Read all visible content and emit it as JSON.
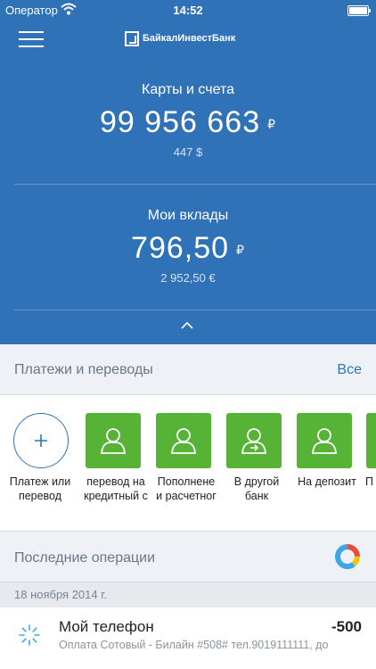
{
  "status": {
    "carrier": "Оператор",
    "time": "14:52"
  },
  "header": {
    "logo_text": "БайкалИнвестБанк"
  },
  "cards": {
    "title": "Карты и счета",
    "amount": "99 956 663",
    "currency": "₽",
    "sub": "447 $"
  },
  "deposits": {
    "title": "Мои вклады",
    "amount": "796,50",
    "currency": "₽",
    "sub": "2 952,50 €"
  },
  "payments": {
    "title": "Платежи и переводы",
    "all_label": "Все",
    "items": [
      {
        "label1": "Платеж или",
        "label2": "перевод",
        "icon": "plus-icon"
      },
      {
        "label1": "перевод на",
        "label2": "кредитный с",
        "icon": "person-icon"
      },
      {
        "label1": "Пополнене",
        "label2": "и расчетног",
        "icon": "person-icon"
      },
      {
        "label1": "В другой",
        "label2": "банк",
        "icon": "person-transfer-icon"
      },
      {
        "label1": "На депозит",
        "label2": "",
        "icon": "person-icon"
      },
      {
        "label1": "П",
        "label2": "",
        "icon": "person-icon"
      }
    ]
  },
  "operations": {
    "title": "Последние операции",
    "date": "18 ноября 2014 г.",
    "items": [
      {
        "name": "Мой телефон",
        "amount": "-500",
        "desc": "Оплата Сотовый - Билайн #508# тел.9019111111, дo"
      }
    ]
  },
  "colors": {
    "primary": "#2f72b8",
    "tile_green": "#57b336",
    "background": "#eef1f5"
  }
}
